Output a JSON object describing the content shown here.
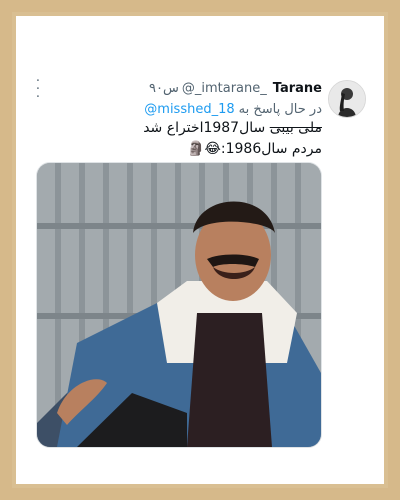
{
  "tweet": {
    "display_name": "Tarane",
    "handle": "@_imtarane_",
    "time": "۹۰س",
    "reply_prefix": "در حال پاسخ به",
    "reply_to": "@misshed_18",
    "line1_struck": "ملی بیبی",
    "line1_rest": " سال1987اختراع شد",
    "line2": "مردم سال1986:😂🗿"
  },
  "icons": {
    "more": "more-vertical-icon",
    "avatar": "user-avatar"
  },
  "colors": {
    "background": "#d6b98a",
    "card": "#ffffff",
    "link": "#1d9bf0",
    "text_primary": "#0f1419",
    "text_secondary": "#536471"
  }
}
